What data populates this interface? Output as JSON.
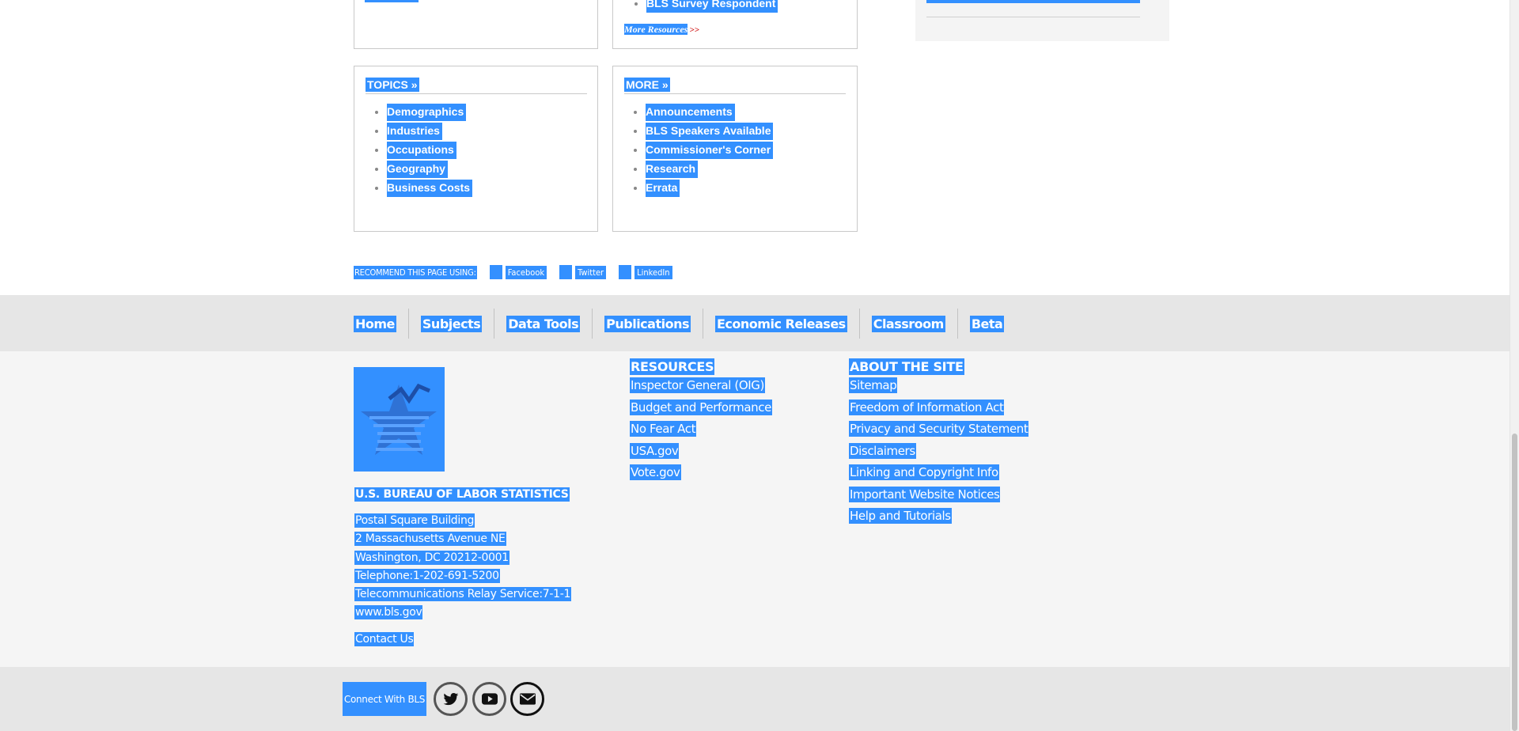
{
  "top_left_box": {},
  "top_middle_box": {
    "last_item": "BLS Survey Respondent",
    "more_link": "More Resources",
    "more_arrow": ">>"
  },
  "topics_box": {
    "title": "TOPICS »",
    "items": [
      "Demographics",
      "Industries",
      "Occupations",
      "Geography",
      "Business Costs"
    ]
  },
  "more_box": {
    "title": "MORE »",
    "items": [
      "Announcements",
      "BLS Speakers Available",
      "Commissioner's Corner",
      "Research",
      "Errata"
    ]
  },
  "recommend": {
    "label": "RECOMMEND THIS PAGE USING:",
    "links": [
      {
        "label": "Facebook",
        "icon": "facebook-icon"
      },
      {
        "label": "Twitter",
        "icon": "twitter-icon"
      },
      {
        "label": "LinkedIn",
        "icon": "linkedin-icon"
      }
    ]
  },
  "nav": {
    "items": [
      "Home",
      "Subjects",
      "Data Tools",
      "Publications",
      "Economic Releases",
      "Classroom",
      "Beta"
    ]
  },
  "footer": {
    "org_name": "U.S. BUREAU OF LABOR STATISTICS",
    "address": [
      "Postal Square Building",
      "2 Massachusetts Avenue NE",
      "Washington, DC 20212-0001"
    ],
    "telephone": "Telephone:1-202-691-5200",
    "relay": "Telecommunications Relay Service:7-1-1",
    "website": "www.bls.gov",
    "contact": "Contact Us",
    "resources": {
      "heading": "RESOURCES",
      "items": [
        "Inspector General (OIG)",
        "Budget and Performance",
        "No Fear Act",
        "USA.gov",
        "Vote.gov"
      ]
    },
    "about": {
      "heading": "ABOUT THE SITE",
      "items": [
        "Sitemap",
        "Freedom of Information Act",
        "Privacy and Security Statement",
        "Disclaimers",
        "Linking and Copyright Info",
        "Important Website Notices",
        "Help and Tutorials"
      ]
    }
  },
  "connect": {
    "label": "Connect With BLS",
    "icons": [
      "twitter-icon",
      "youtube-icon",
      "email-icon"
    ]
  },
  "colors": {
    "selection": "#3390ff",
    "nav_band": "#e6e6e6",
    "footer_bg": "#f5f5f5",
    "arrow_red": "#cc0000"
  }
}
